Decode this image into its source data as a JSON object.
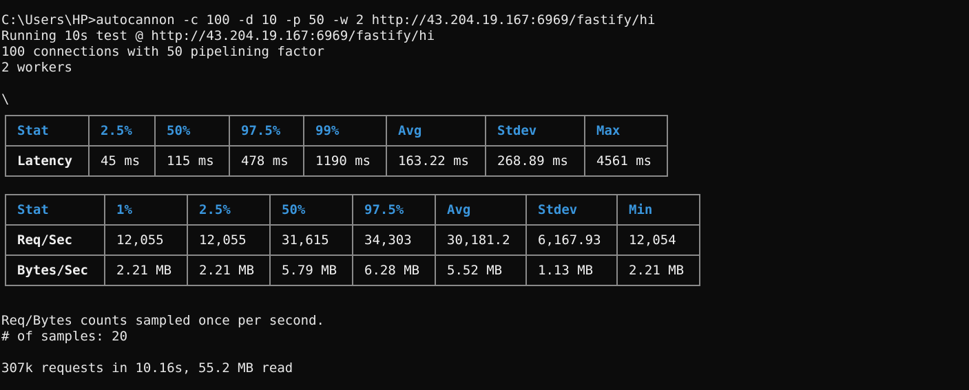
{
  "header_lines": [
    "C:\\Users\\HP>autocannon -c 100 -d 10 -p 50 -w 2 http://43.204.19.167:6969/fastify/hi",
    "Running 10s test @ http://43.204.19.167:6969/fastify/hi",
    "100 connections with 50 pipelining factor",
    "2 workers",
    "",
    "\\"
  ],
  "latency_table": {
    "headers": [
      "Stat",
      "2.5%",
      "50%",
      "97.5%",
      "99%",
      "Avg",
      "Stdev",
      "Max"
    ],
    "rows": [
      [
        "Latency",
        "45 ms",
        "115 ms",
        "478 ms",
        "1190 ms",
        "163.22 ms",
        "268.89 ms",
        "4561 ms"
      ]
    ]
  },
  "throughput_table": {
    "headers": [
      "Stat",
      "1%",
      "2.5%",
      "50%",
      "97.5%",
      "Avg",
      "Stdev",
      "Min"
    ],
    "rows": [
      [
        "Req/Sec",
        "12,055",
        "12,055",
        "31,615",
        "34,303",
        "30,181.2",
        "6,167.93",
        "12,054"
      ],
      [
        "Bytes/Sec",
        "2.21 MB",
        "2.21 MB",
        "5.79 MB",
        "6.28 MB",
        "5.52 MB",
        "1.13 MB",
        "2.21 MB"
      ]
    ]
  },
  "footer_lines": [
    "Req/Bytes counts sampled once per second.",
    "# of samples: 20",
    "",
    "307k requests in 10.16s, 55.2 MB read"
  ]
}
